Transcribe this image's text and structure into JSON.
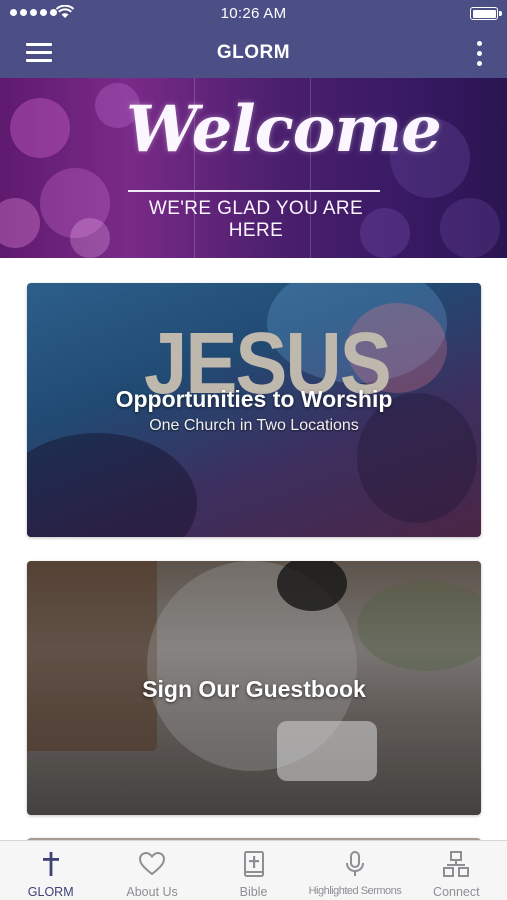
{
  "status_bar": {
    "time": "10:26 AM",
    "signal_icon": "signal-dots-icon",
    "wifi_icon": "wifi-icon",
    "battery_icon": "battery-full-icon"
  },
  "navbar": {
    "title": "GLORM",
    "menu_icon": "hamburger-menu-icon",
    "more_icon": "more-vertical-icon",
    "color": "#4b4f86"
  },
  "banner": {
    "title": "Welcome",
    "subtitle": "WE'RE GLAD YOU ARE HERE"
  },
  "cards": [
    {
      "background_text": "JESUS",
      "title": "Opportunities to Worship",
      "subtitle": "One Church in Two Locations"
    },
    {
      "title": "Sign Our Guestbook"
    }
  ],
  "tabbar": {
    "active": "GLORM",
    "active_color": "#3e4276",
    "inactive_color": "#8e8e93",
    "tabs": [
      {
        "label": "GLORM",
        "icon": "cross-icon"
      },
      {
        "label": "About Us",
        "icon": "heart-icon"
      },
      {
        "label": "Bible",
        "icon": "bible-icon"
      },
      {
        "label": "Highlighted Sermons",
        "icon": "microphone-icon"
      },
      {
        "label": "Connect",
        "icon": "connect-network-icon"
      }
    ]
  }
}
